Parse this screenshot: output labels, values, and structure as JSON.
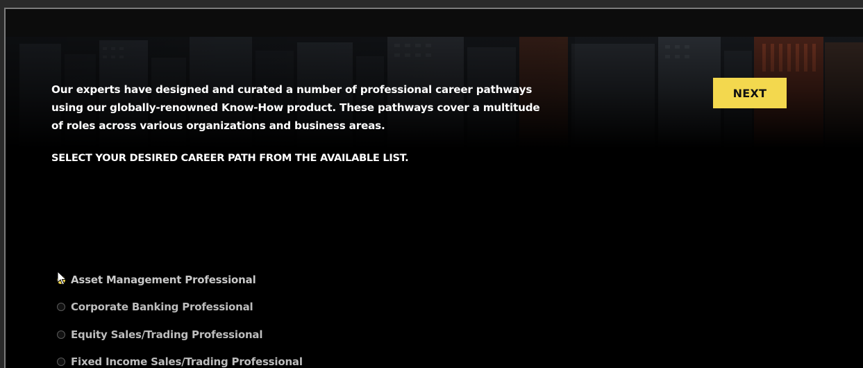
{
  "intro": {
    "text": "Our experts have designed and curated a number of professional career pathways using our globally-renowned Know-How product. These pathways cover a multitude of roles across various organizations and business areas."
  },
  "instruction": "SELECT YOUR DESIRED CAREER PATH FROM THE AVAILABLE LIST.",
  "next_button": {
    "label": "NEXT"
  },
  "career_paths": {
    "selected_index": 0,
    "options": [
      {
        "label": "Asset Management Professional",
        "selected": true
      },
      {
        "label": "Corporate Banking Professional",
        "selected": false
      },
      {
        "label": "Equity Sales/Trading Professional",
        "selected": false
      },
      {
        "label": "Fixed Income Sales/Trading Professional",
        "selected": false
      }
    ]
  },
  "colors": {
    "accent": "#f3d84e",
    "background": "#000000",
    "text": "#ffffff",
    "option_text": "#bdbdbd"
  },
  "icons": {
    "cursor": "mouse-pointer-icon",
    "radio": "radio-circle-icon"
  }
}
